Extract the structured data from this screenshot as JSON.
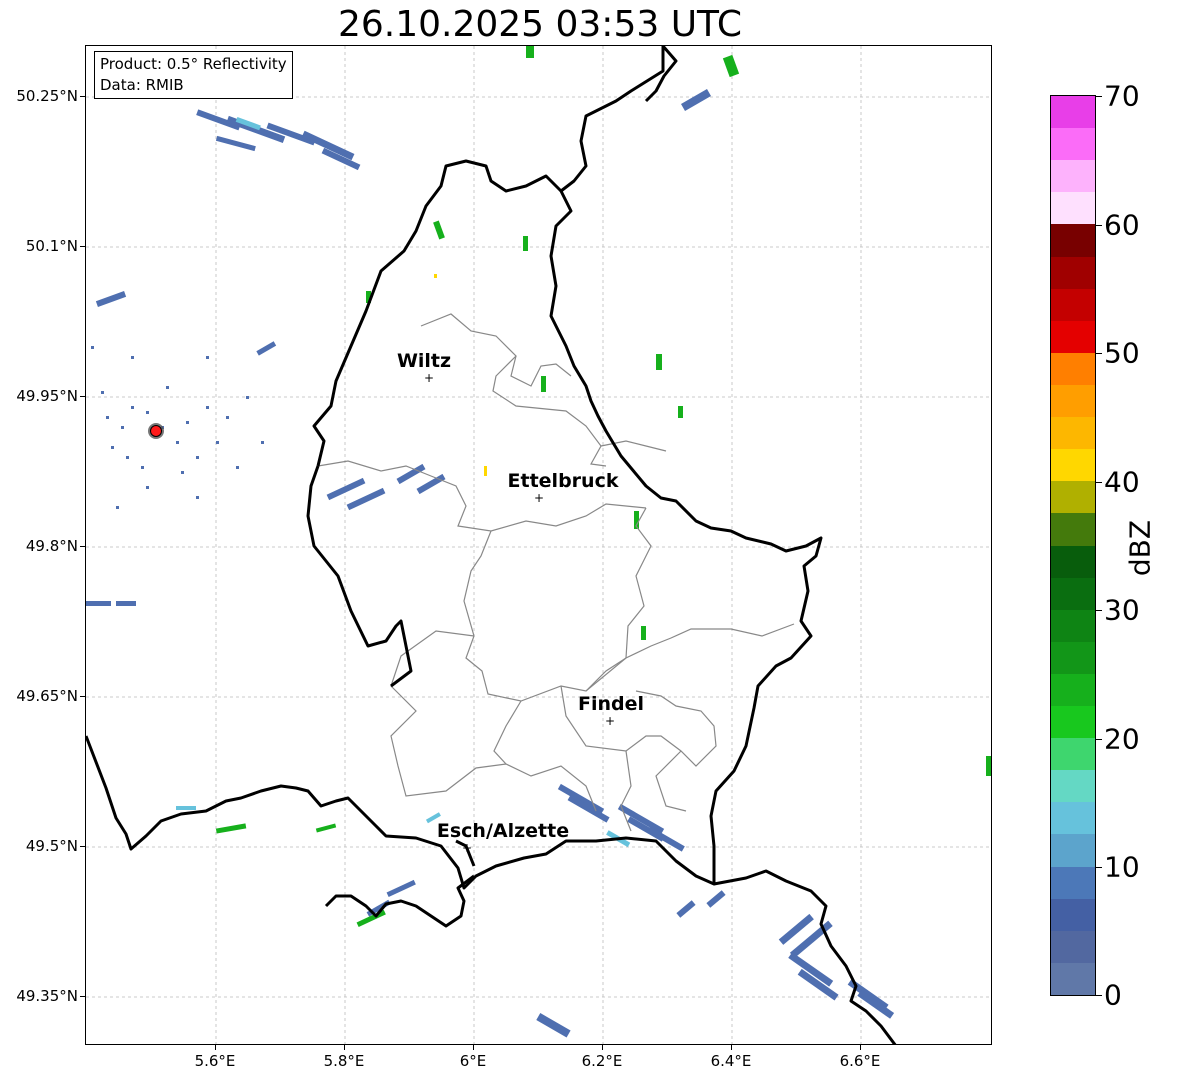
{
  "title": "26.10.2025 03:53 UTC",
  "info": {
    "product": "Product: 0.5° Reflectivity",
    "data": "Data: RMIB"
  },
  "axes": {
    "y_ticks": [
      "50.25°N",
      "50.1°N",
      "49.95°N",
      "49.8°N",
      "49.65°N",
      "49.5°N",
      "49.35°N"
    ],
    "x_ticks": [
      "5.6°E",
      "5.8°E",
      "6°E",
      "6.2°E",
      "6.4°E",
      "6.6°E"
    ]
  },
  "cities": [
    {
      "name": "Wiltz"
    },
    {
      "name": "Ettelbruck"
    },
    {
      "name": "Findel"
    },
    {
      "name": "Esch/Alzette"
    }
  ],
  "colorbar": {
    "unit": "dBZ",
    "labels": [
      "70",
      "60",
      "50",
      "40",
      "30",
      "20",
      "10",
      "0"
    ],
    "colors": [
      "#e83ee8",
      "#fb6cf8",
      "#fdb2fc",
      "#fee0fe",
      "#780000",
      "#a00000",
      "#c40000",
      "#e40000",
      "#ff7f00",
      "#ff9e00",
      "#fdb700",
      "#ffd700",
      "#b0b000",
      "#447a0c",
      "#085d0c",
      "#0a6e10",
      "#0e8414",
      "#129618",
      "#16b01c",
      "#18c81e",
      "#3ed66e",
      "#64d8c4",
      "#66c2dc",
      "#5ca4cc",
      "#4c78b8",
      "#4460a4",
      "#5268a0",
      "#6078a8"
    ]
  },
  "markers": {
    "radar_site_color": "#ff1a1a"
  }
}
